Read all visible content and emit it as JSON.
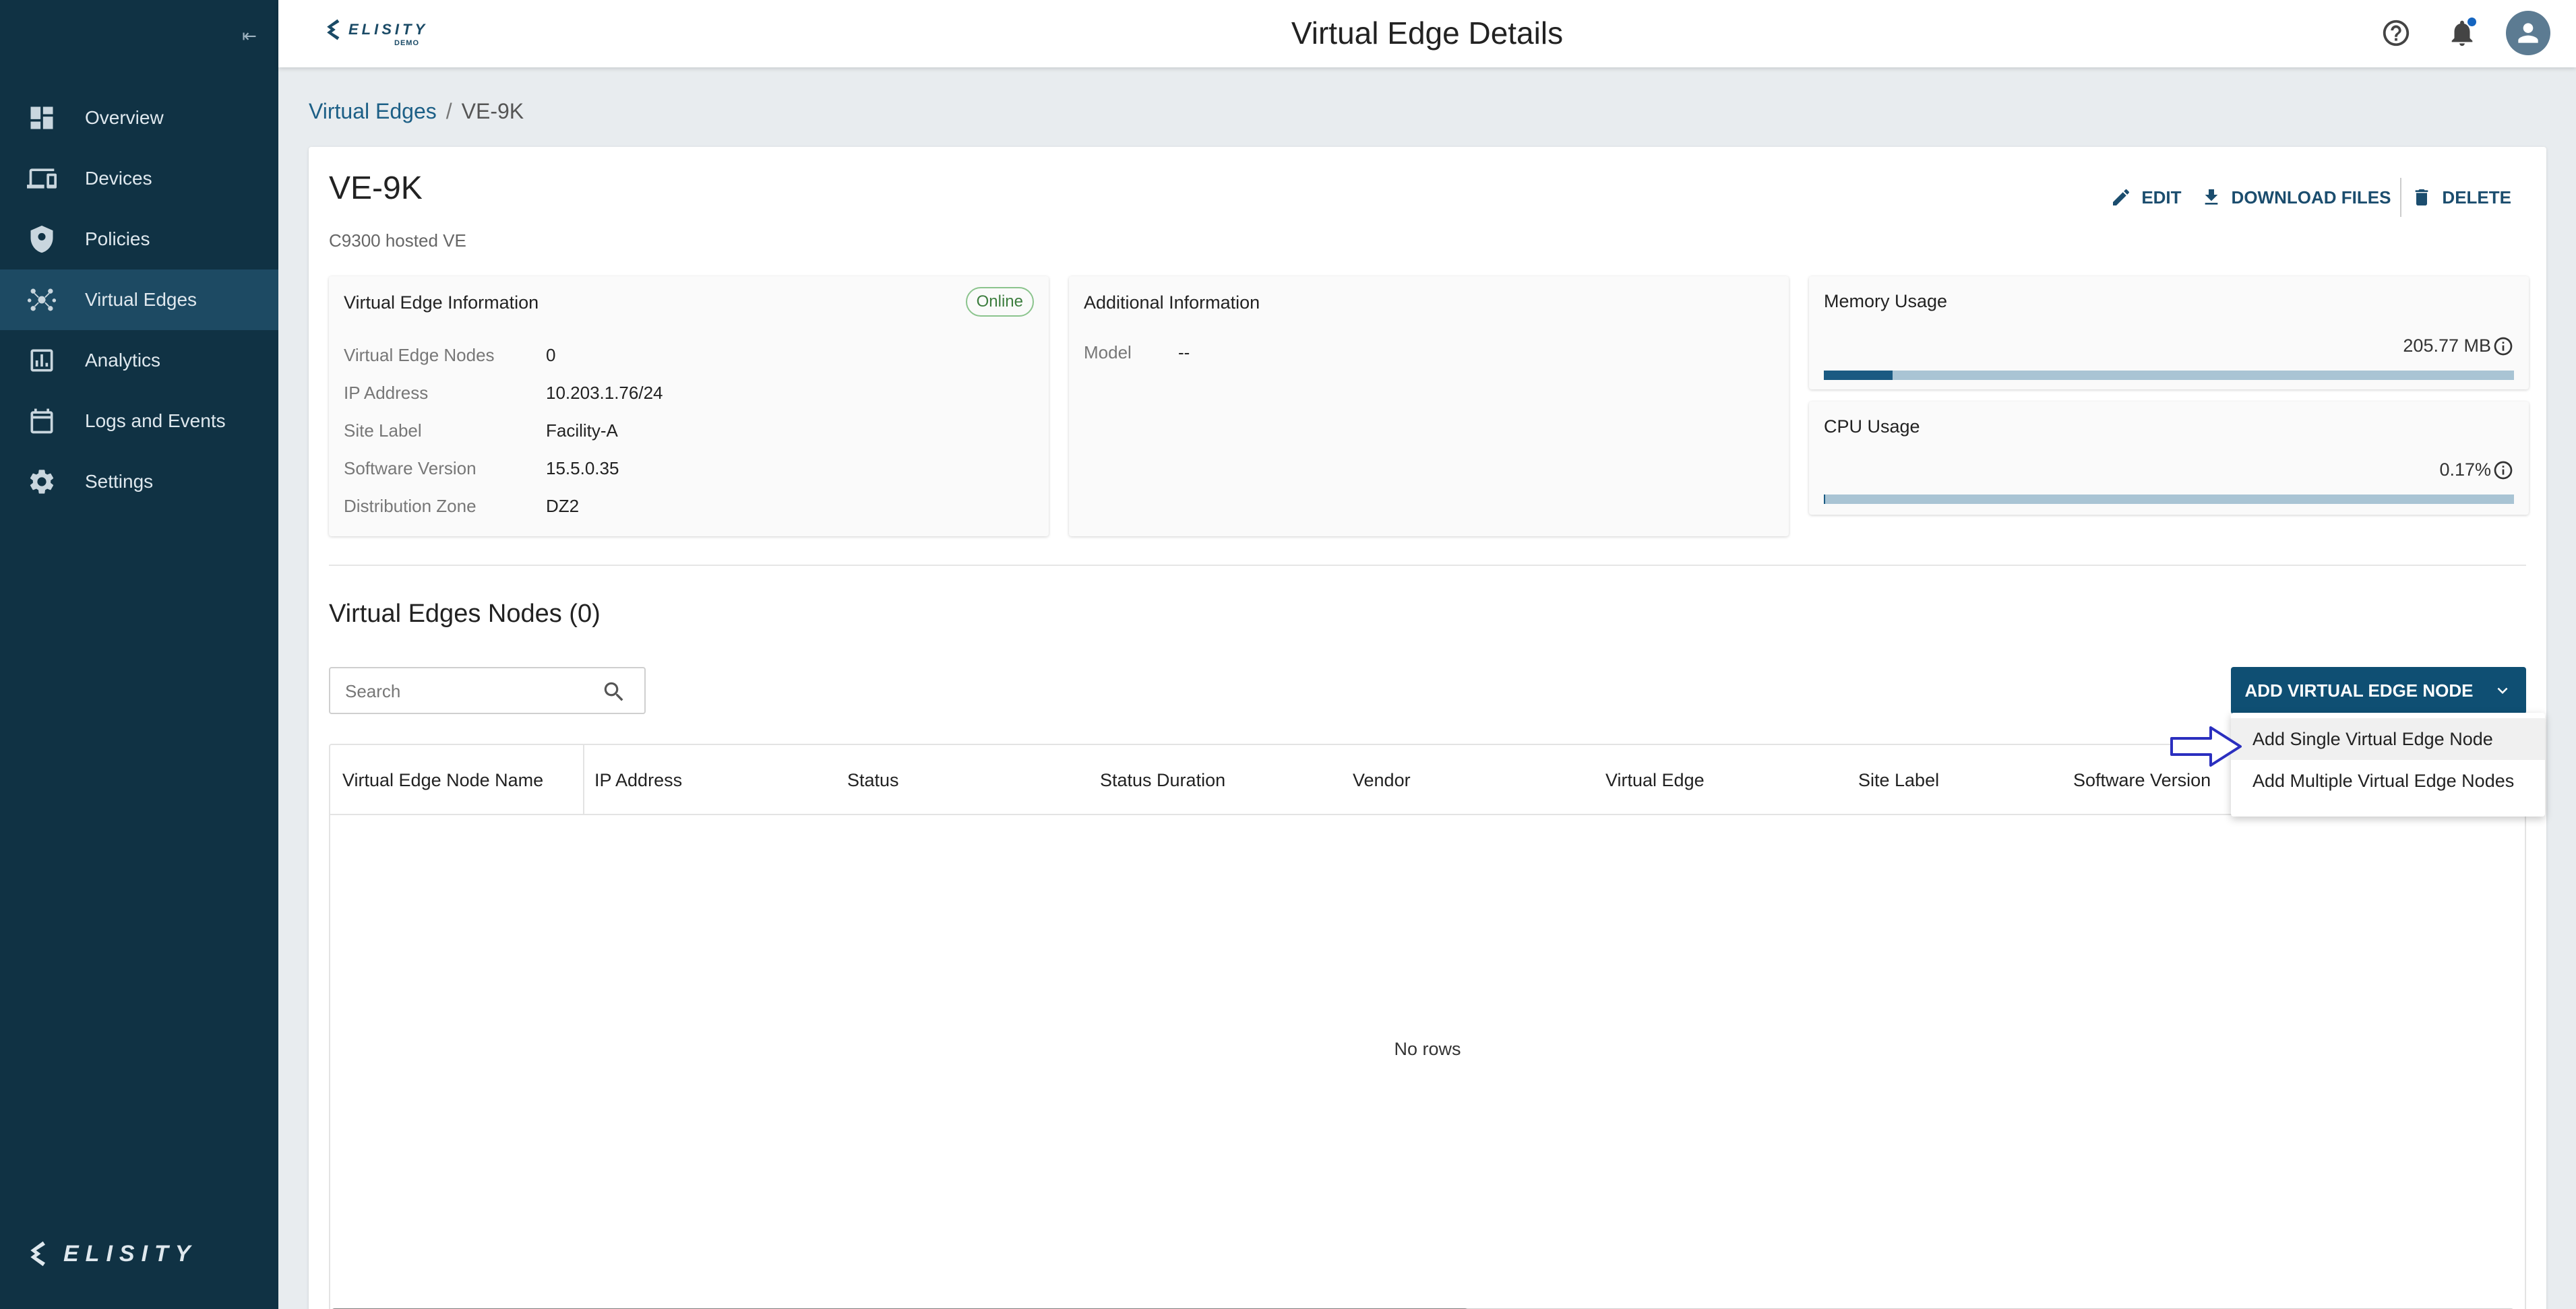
{
  "sidebar": {
    "collapse_label": "⇤",
    "items": [
      {
        "label": "Overview",
        "icon": "dashboard-icon"
      },
      {
        "label": "Devices",
        "icon": "devices-icon"
      },
      {
        "label": "Policies",
        "icon": "shield-icon"
      },
      {
        "label": "Virtual Edges",
        "icon": "hub-icon",
        "active": true
      },
      {
        "label": "Analytics",
        "icon": "analytics-icon"
      },
      {
        "label": "Logs and Events",
        "icon": "calendar-icon"
      },
      {
        "label": "Settings",
        "icon": "gear-icon"
      }
    ],
    "logo_text": "ELISITY"
  },
  "header": {
    "brand_text": "ELISITY",
    "brand_sub": "DEMO",
    "title": "Virtual Edge Details",
    "notification_dot_color": "#1565c0"
  },
  "breadcrumb": {
    "parent": "Virtual Edges",
    "separator": "/",
    "current": "VE-9K"
  },
  "details": {
    "name": "VE-9K",
    "description": "C9300 hosted VE",
    "actions": {
      "edit": "EDIT",
      "download": "DOWNLOAD FILES",
      "delete": "DELETE"
    },
    "ve_info": {
      "title": "Virtual Edge Information",
      "status": "Online",
      "rows": [
        {
          "key": "Virtual Edge Nodes",
          "value": "0"
        },
        {
          "key": "IP Address",
          "value": "10.203.1.76/24"
        },
        {
          "key": "Site Label",
          "value": "Facility-A"
        },
        {
          "key": "Software Version",
          "value": "15.5.0.35"
        },
        {
          "key": "Distribution Zone",
          "value": "DZ2"
        }
      ]
    },
    "additional_info": {
      "title": "Additional Information",
      "rows": [
        {
          "key": "Model",
          "value": "--"
        }
      ]
    },
    "memory": {
      "title": "Memory Usage",
      "value": "205.77 MB",
      "fill_fraction": 0.1
    },
    "cpu": {
      "title": "CPU Usage",
      "value": "0.17%",
      "fill_fraction": 0.0017
    }
  },
  "nodes": {
    "title": "Virtual Edges Nodes (0)",
    "search_placeholder": "Search",
    "add_button": "ADD VIRTUAL EDGE NODE",
    "columns": [
      "Virtual Edge Node Name",
      "IP Address",
      "Status",
      "Status Duration",
      "Vendor",
      "Virtual Edge",
      "Site Label",
      "Software Version"
    ],
    "empty_text": "No rows",
    "dropdown": [
      "Add Single Virtual Edge Node",
      "Add Multiple Virtual Edge Nodes"
    ]
  },
  "colors": {
    "sidebar_bg": "#103244",
    "sidebar_active": "#1d4a63",
    "primary": "#0f4f73",
    "status_online": "#3c7d3e",
    "annotation_arrow": "#2b2fbf"
  }
}
